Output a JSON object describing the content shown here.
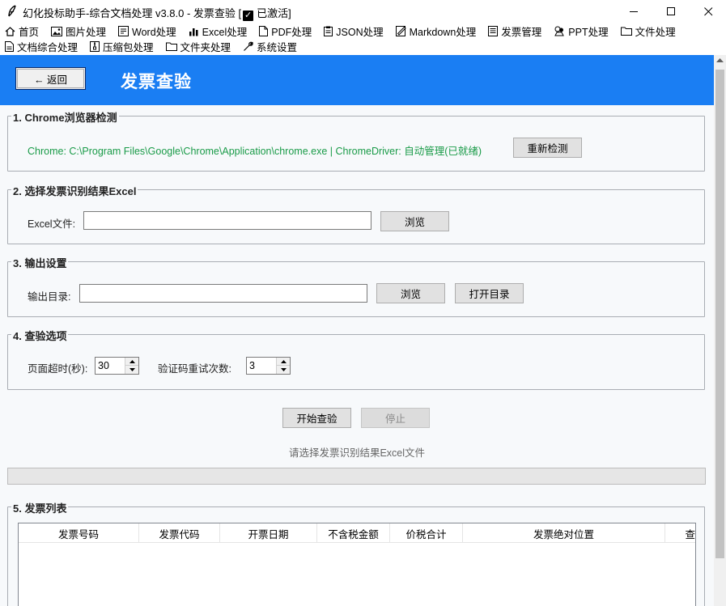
{
  "window": {
    "title": "幻化投标助手-综合文档处理 v3.8.0 - 发票查验 [",
    "title_activated": "已激活]"
  },
  "menu": {
    "row1": [
      {
        "label": "首页",
        "icon": "home-icon"
      },
      {
        "label": "图片处理",
        "icon": "image-icon"
      },
      {
        "label": "Word处理",
        "icon": "word-icon"
      },
      {
        "label": "Excel处理",
        "icon": "chart-icon"
      },
      {
        "label": "PDF处理",
        "icon": "pdf-icon"
      },
      {
        "label": "JSON处理",
        "icon": "clipboard-icon"
      },
      {
        "label": "Markdown处理",
        "icon": "markdown-icon"
      },
      {
        "label": "发票管理",
        "icon": "invoice-icon"
      },
      {
        "label": "PPT处理",
        "icon": "ppt-icon"
      },
      {
        "label": "文件处理",
        "icon": "folder-icon"
      }
    ],
    "row2": [
      {
        "label": "文档综合处理",
        "icon": "document-icon"
      },
      {
        "label": "压缩包处理",
        "icon": "archive-icon"
      },
      {
        "label": "文件夹处理",
        "icon": "folder-icon"
      },
      {
        "label": "系统设置",
        "icon": "wrench-icon"
      }
    ]
  },
  "header": {
    "back_label": "← 返回",
    "title": "发票查验",
    "accent_color": "#1a7ef3"
  },
  "section1": {
    "title": "1. Chrome浏览器检测",
    "status": "Chrome: C:\\Program Files\\Google\\Chrome\\Application\\chrome.exe | ChromeDriver: 自动管理(已就绪)",
    "redetect_label": "重新检测"
  },
  "section2": {
    "title": "2. 选择发票识别结果Excel",
    "excel_label": "Excel文件:",
    "excel_value": "",
    "browse_label": "浏览"
  },
  "section3": {
    "title": "3. 输出设置",
    "output_label": "输出目录:",
    "output_value": "",
    "browse_label": "浏览",
    "open_dir_label": "打开目录"
  },
  "section4": {
    "title": "4. 查验选项",
    "timeout_label": "页面超时(秒):",
    "timeout_value": "30",
    "retry_label": "验证码重试次数:",
    "retry_value": "3"
  },
  "actions": {
    "start_label": "开始查验",
    "stop_label": "停止",
    "status_message": "请选择发票识别结果Excel文件"
  },
  "section5": {
    "title": "5. 发票列表",
    "columns": [
      "发票号码",
      "发票代码",
      "开票日期",
      "不含税金额",
      "价税合计",
      "发票绝对位置",
      "查"
    ]
  }
}
